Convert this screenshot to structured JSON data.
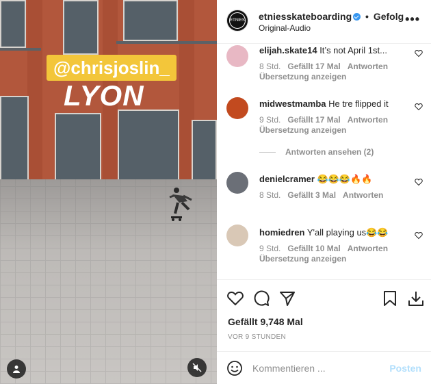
{
  "video": {
    "tag_text": "@chrisjoslin_",
    "city_text": "LYON"
  },
  "header": {
    "username": "etniesskateboarding",
    "follow_label": "Gefolg",
    "subtitle": "Original-Audio",
    "more_icon": "more-horizontal-icon",
    "avatar_text": "ETNIES"
  },
  "comments": [
    {
      "user": "elijah.skate14",
      "text": "It’s not April 1st...",
      "time": "8 Std.",
      "likes": "Gefällt 17 Mal",
      "reply": "Antworten",
      "translate": "Übersetzung anzeigen",
      "avatar_color": "#e8b8c4"
    },
    {
      "user": "midwestmamba",
      "text": "He tre flipped it",
      "time": "9 Std.",
      "likes": "Gefällt 17 Mal",
      "reply": "Antworten",
      "translate": "Übersetzung anzeigen",
      "avatar_color": "#c24a1f"
    },
    {
      "user": "denielcramer",
      "text": "😂😂😂🔥🔥",
      "time": "8 Std.",
      "likes": "Gefällt 3 Mal",
      "reply": "Antworten",
      "translate": "",
      "avatar_color": "#6b6f77"
    },
    {
      "user": "homiedren",
      "text": "Y'all playing us😂😂",
      "time": "9 Std.",
      "likes": "Gefällt 10 Mal",
      "reply": "Antworten",
      "translate": "Übersetzung anzeigen",
      "avatar_color": "#d9c8b6"
    }
  ],
  "replies_label": "Antworten ansehen (2)",
  "likes_total": "Gefällt 9,748 Mal",
  "posted_time": "VOR 9 STUNDEN",
  "composer": {
    "placeholder": "Kommentieren ...",
    "post_label": "Posten"
  },
  "colors": {
    "accent": "#3897f0",
    "post_disabled": "#b2dffc",
    "muted": "#8e8e8e",
    "tag_yellow": "#f3c63a"
  }
}
